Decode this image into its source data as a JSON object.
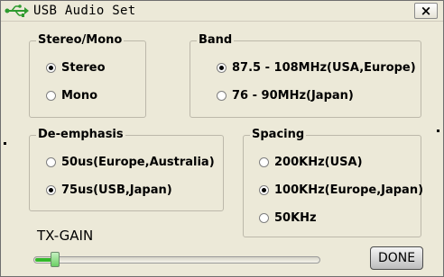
{
  "window": {
    "title": "USB Audio Set",
    "close_label": "×"
  },
  "groups": {
    "stereo_mono": {
      "label": "Stereo/Mono",
      "options": [
        {
          "label": "Stereo",
          "checked": true
        },
        {
          "label": "Mono",
          "checked": false
        }
      ]
    },
    "band": {
      "label": "Band",
      "options": [
        {
          "label": "87.5 - 108MHz(USA,Europe)",
          "checked": true
        },
        {
          "label": "76 - 90MHz(Japan)",
          "checked": false
        }
      ]
    },
    "deemphasis": {
      "label": "De-emphasis",
      "options": [
        {
          "label": "50us(Europe,Australia)",
          "checked": false
        },
        {
          "label": "75us(USB,Japan)",
          "checked": true
        }
      ]
    },
    "spacing": {
      "label": "Spacing",
      "options": [
        {
          "label": "200KHz(USA)",
          "checked": false
        },
        {
          "label": "100KHz(Europe,Japan)",
          "checked": true
        },
        {
          "label": "50KHz",
          "checked": false
        }
      ]
    }
  },
  "tx_gain": {
    "label": "TX-GAIN",
    "level": 0.05
  },
  "buttons": {
    "done_label": "DONE"
  },
  "icons": {
    "title_icon": "usb-icon",
    "close_icon": "close-icon"
  },
  "colors": {
    "background": "#ece9d8",
    "slider_fill": "#32b82a",
    "usb_icon": "#2e9b2e"
  }
}
